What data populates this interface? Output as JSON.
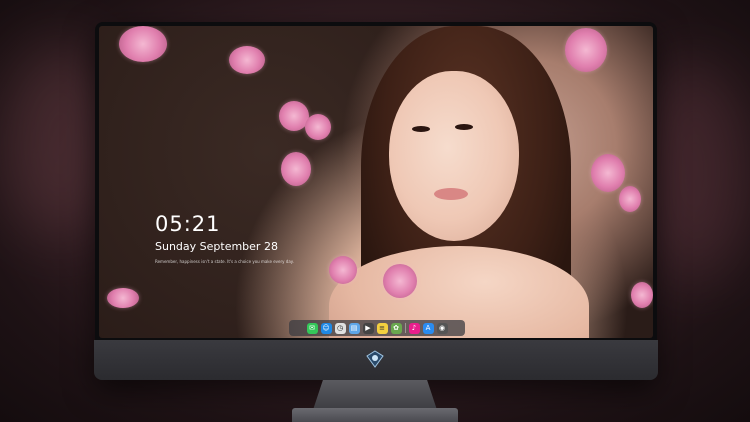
{
  "lockscreen": {
    "time": "05:21",
    "date": "Sunday September  28",
    "subtitle": "Remember, happiness isn't a state. It's a choice you make every day."
  },
  "dock": {
    "items": [
      {
        "name": "messages",
        "glyph": "✉",
        "color": "#34c759"
      },
      {
        "name": "finder",
        "glyph": "☺",
        "color": "#1e88e5"
      },
      {
        "name": "clock",
        "glyph": "◷",
        "color": "#e0e0e0"
      },
      {
        "name": "preview",
        "glyph": "▤",
        "color": "#5ea6e8"
      },
      {
        "name": "movie",
        "glyph": "▶",
        "color": "#444"
      },
      {
        "name": "notes",
        "glyph": "≡",
        "color": "#f4d03f"
      },
      {
        "name": "photos",
        "glyph": "✿",
        "color": "#6aa84f"
      },
      {
        "name": "music",
        "glyph": "♪",
        "color": "#e91e8c"
      },
      {
        "name": "appstore",
        "glyph": "A",
        "color": "#2a8cf0"
      },
      {
        "name": "camera",
        "glyph": "◉",
        "color": "#555"
      }
    ]
  }
}
